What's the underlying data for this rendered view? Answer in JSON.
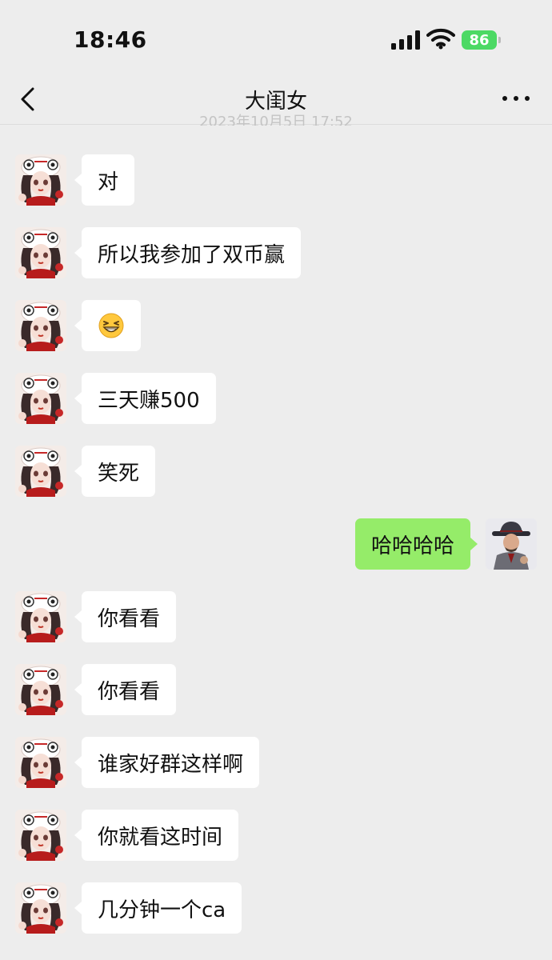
{
  "status_bar": {
    "time": "18:46",
    "battery": "86",
    "signal_icon": "cellular-signal-icon",
    "wifi_icon": "wifi-icon"
  },
  "header": {
    "title": "大闺女",
    "timestamp": "2023年10月5日 17:52"
  },
  "colors": {
    "background": "#ededed",
    "incoming_bubble": "#ffffff",
    "outgoing_bubble": "#95ec69",
    "battery": "#4cd964"
  },
  "messages": [
    {
      "side": "left",
      "text": "对"
    },
    {
      "side": "left",
      "text": "所以我参加了双币赢"
    },
    {
      "side": "left",
      "emoji": "grinning-squinting-face-icon",
      "text": ""
    },
    {
      "side": "left",
      "text": "三天赚500"
    },
    {
      "side": "left",
      "text": "笑死"
    },
    {
      "side": "right",
      "text": "哈哈哈哈"
    },
    {
      "side": "left",
      "text": "你看看"
    },
    {
      "side": "left",
      "text": "你看看"
    },
    {
      "side": "left",
      "text": "谁家好群这样啊"
    },
    {
      "side": "left",
      "text": "你就看这时间"
    },
    {
      "side": "left",
      "text": "几分钟一个ca"
    }
  ]
}
